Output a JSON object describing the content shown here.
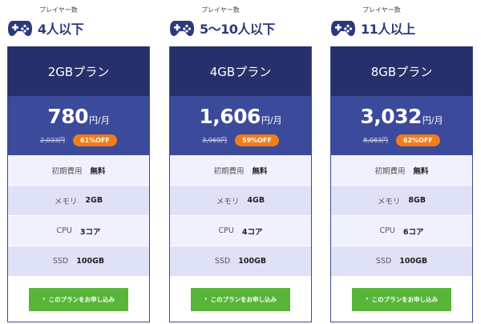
{
  "plans": [
    {
      "player_label": "プレイヤー数",
      "player_count": "4人以下",
      "plan_name": "2GBプラン",
      "price": "780",
      "price_unit": "円/月",
      "original_price": "2,033円",
      "discount": "61%OFF",
      "specs": [
        {
          "label": "初期費用",
          "value": "無料"
        },
        {
          "label": "メモリ",
          "value": "2GB"
        },
        {
          "label": "CPU",
          "value": "3コア"
        },
        {
          "label": "SSD",
          "value": "100GB"
        }
      ],
      "cta_label": "このプランをお申し込み"
    },
    {
      "player_label": "プレイヤー数",
      "player_count": "5～10人以下",
      "plan_name": "4GBプラン",
      "price": "1,606",
      "price_unit": "円/月",
      "original_price": "3,969円",
      "discount": "59%OFF",
      "specs": [
        {
          "label": "初期費用",
          "value": "無料"
        },
        {
          "label": "メモリ",
          "value": "4GB"
        },
        {
          "label": "CPU",
          "value": "4コア"
        },
        {
          "label": "SSD",
          "value": "100GB"
        }
      ],
      "cta_label": "このプランをお申し込み"
    },
    {
      "player_label": "プレイヤー数",
      "player_count": "11人以上",
      "plan_name": "8GBプラン",
      "price": "3,032",
      "price_unit": "円/月",
      "original_price": "8,083円",
      "discount": "62%OFF",
      "specs": [
        {
          "label": "初期費用",
          "value": "無料"
        },
        {
          "label": "メモリ",
          "value": "8GB"
        },
        {
          "label": "CPU",
          "value": "6コア"
        },
        {
          "label": "SSD",
          "value": "100GB"
        }
      ],
      "cta_label": "このプランをお申し込み"
    }
  ],
  "colors": {
    "header_dark": "#27306b",
    "header_mid": "#3c4a9b",
    "discount_badge": "#f07c1c",
    "cta_green": "#58b53a",
    "spec_row_light": "#f0f1fc",
    "spec_row_dark": "#dfe2f7",
    "player_count_text": "#2b3a7a"
  },
  "icons": {
    "header": "gamepad-icon",
    "cta": "chevron-right-icon"
  }
}
